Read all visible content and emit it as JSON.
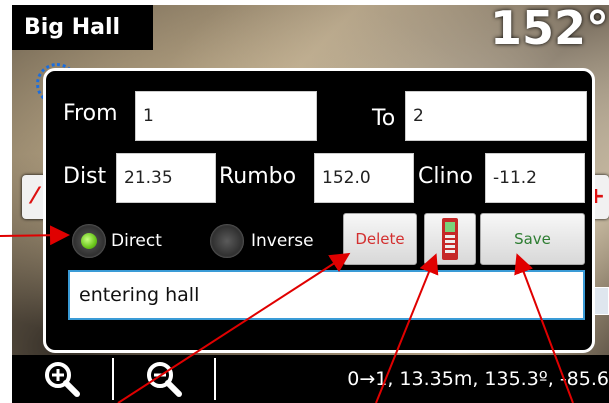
{
  "app": {
    "title": "Big Hall",
    "heading": "152°",
    "side_peek": "("
  },
  "dialog": {
    "from_label": "From",
    "from_value": "1",
    "to_label": "To",
    "to_value": "2",
    "dist_label": "Dist",
    "dist_value": "21.35",
    "rumbo_label": "Rumbo",
    "rumbo_value": "152.0",
    "clino_label": "Clino",
    "clino_value": "-11.2",
    "direct_label": "Direct",
    "inverse_label": "Inverse",
    "direct_selected": true,
    "delete_label": "Delete",
    "save_label": "Save",
    "device_icon": "disto-device-icon",
    "comment_value": "entering hall"
  },
  "colors": {
    "delete_text": "#d32f2f",
    "save_text": "#2e7d32",
    "radio_selected": "#6ac51b",
    "arrow": "#e00000",
    "comment_border": "#3a9bd6"
  },
  "bottom_bar": {
    "zoom_in_icon": "zoom-in-icon",
    "zoom_out_icon": "zoom-out-icon",
    "status": "0→1, 13.35m, 135.3º, -85.6"
  }
}
